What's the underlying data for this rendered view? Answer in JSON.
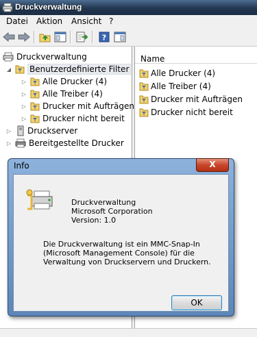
{
  "window": {
    "title": "Druckverwaltung"
  },
  "menu": [
    "Datei",
    "Aktion",
    "Ansicht",
    "?"
  ],
  "toolbar": {
    "icons": [
      "back-icon",
      "forward-icon",
      "up-folder-icon",
      "show-hide-tree-icon",
      "export-list-icon",
      "help-icon",
      "properties-icon"
    ]
  },
  "tree": {
    "root": "Druckverwaltung",
    "custom_filters": "Benutzerdefinierte Filter",
    "filters": [
      "Alle Drucker (4)",
      "Alle Treiber (4)",
      "Drucker mit Aufträgen",
      "Drucker nicht bereit"
    ],
    "print_servers": "Druckserver",
    "deployed_printers": "Bereitgestellte Drucker"
  },
  "list": {
    "column_name": "Name",
    "items": [
      "Alle Drucker (4)",
      "Alle Treiber (4)",
      "Drucker mit Aufträgen",
      "Drucker nicht bereit"
    ]
  },
  "dialog": {
    "title": "Info",
    "close_label": "X",
    "product": "Druckverwaltung",
    "company": "Microsoft Corporation",
    "version": "Version: 1.0",
    "description": [
      "Die Druckverwaltung ist ein MMC-Snap-In",
      "(Microsoft Management Console) für die",
      "Verwaltung von Druckservern und Druckern."
    ],
    "ok_label": "OK"
  },
  "colors": {
    "titlebar": "#22364f",
    "dialog_frame": "#5d86b8",
    "close_button": "#c8452a"
  }
}
